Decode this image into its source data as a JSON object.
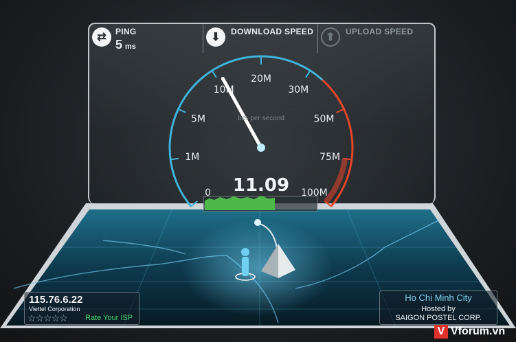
{
  "header": {
    "ping": {
      "label": "PING",
      "value": "5",
      "unit": "ms",
      "icon": "ping-arrows-icon"
    },
    "download": {
      "label": "DOWNLOAD SPEED",
      "icon": "download-arrow-icon"
    },
    "upload": {
      "label": "UPLOAD SPEED",
      "icon": "upload-arrow-icon"
    }
  },
  "gauge": {
    "current_speed": "11.09",
    "current_value": 11.09,
    "caption": "bits per second",
    "ticks": [
      "0",
      "1M",
      "5M",
      "10M",
      "20M",
      "30M",
      "50M",
      "75M",
      "100M"
    ],
    "accent_color": "#3fb4d8",
    "warn_color": "#e5462a"
  },
  "isp": {
    "ip": "115.76.6.22",
    "name": "Viettel Corporation",
    "rating_stars": 5,
    "rate_label": "Rate Your ISP"
  },
  "server": {
    "city": "Ho Chi Minh City",
    "hosted_by": "Hosted by",
    "provider": "SAIGON POSTEL CORP."
  },
  "watermark": {
    "logo_letter": "V",
    "site": "Vforum.vn"
  }
}
